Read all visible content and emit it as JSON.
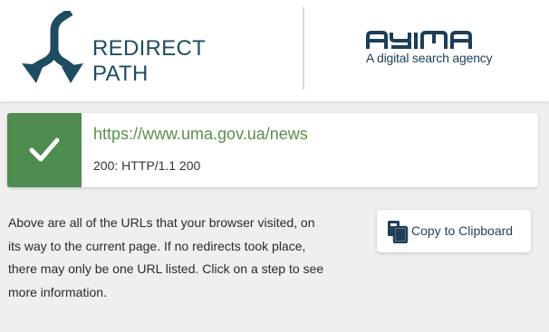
{
  "header": {
    "product_name": "REDIRECT PATH",
    "partner_logo_text": "AYIMA",
    "partner_tagline": "A digital search agency"
  },
  "redirects": [
    {
      "url": "https://www.uma.gov.ua/news",
      "status": "200: HTTP/1.1 200",
      "status_icon": "check-icon",
      "status_color": "#4e8c4f"
    }
  ],
  "info_text": "Above are all of the URLs that your browser visited, on its way to the current page. If no redirects took place, there may only be one URL listed. Click on a step to see more information.",
  "copy_button": {
    "label": "Copy to Clipboard",
    "icon": "clipboard-icon"
  },
  "colors": {
    "brand": "#1e4d63",
    "success": "#4e8c4f",
    "url": "#5a8f4c",
    "background": "#efefef"
  }
}
